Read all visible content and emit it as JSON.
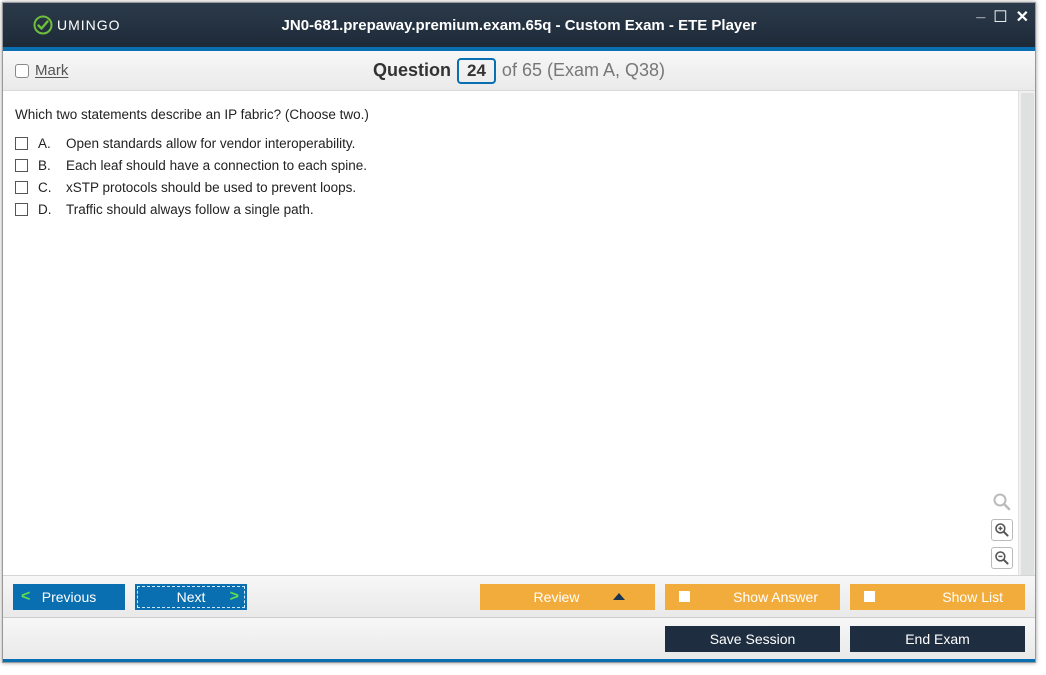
{
  "app": {
    "logo_text": "UMINGO",
    "title": "JN0-681.prepaway.premium.exam.65q - Custom Exam - ETE Player"
  },
  "header": {
    "mark_label": "Mark",
    "question_word": "Question",
    "question_num": "24",
    "of_text": "of 65 (Exam A, Q38)"
  },
  "question": {
    "stem": "Which two statements describe an IP fabric? (Choose two.)",
    "options": [
      {
        "letter": "A.",
        "text": "Open standards allow for vendor interoperability."
      },
      {
        "letter": "B.",
        "text": "Each leaf should have a connection to each spine."
      },
      {
        "letter": "C.",
        "text": "xSTP protocols should be used to prevent loops."
      },
      {
        "letter": "D.",
        "text": "Traffic should always follow a single path."
      }
    ]
  },
  "buttons": {
    "previous": "Previous",
    "next": "Next",
    "review": "Review",
    "show_answer": "Show Answer",
    "show_list": "Show List",
    "save_session": "Save Session",
    "end_exam": "End Exam"
  }
}
